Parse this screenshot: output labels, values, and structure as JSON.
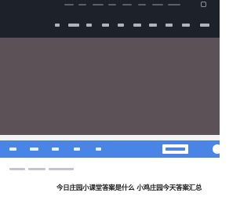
{
  "article": {
    "title": "今日庄园小课堂答案是什么 小鸡庄园今天答案汇总"
  },
  "colors": {
    "header_bg": "#1d2129",
    "banner_bg": "#5d5158",
    "channel_bar_bg": "#4a85e6",
    "title_text": "#222222"
  },
  "icons": {
    "top_right": "user-icon",
    "channel_right": "search-icon"
  }
}
